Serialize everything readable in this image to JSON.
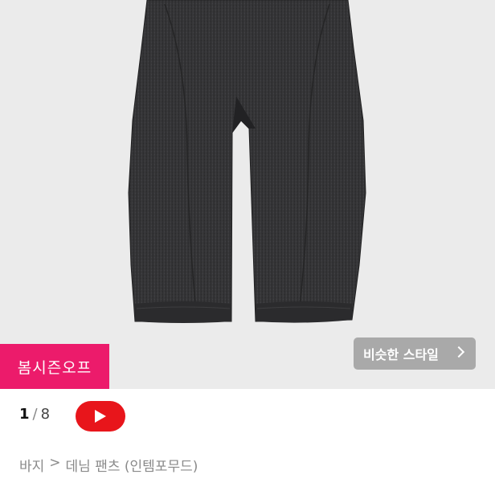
{
  "hero": {
    "product_image": "dark-grey-denim-balloon-pants",
    "sale_badge_label": "봄시즌오프",
    "similar_style_label": "비슷한 스타일",
    "chevron_icon": "chevron-right-icon"
  },
  "gallery": {
    "current_page": "1",
    "separator": "/",
    "total_pages": "8",
    "video_icon": "youtube-play-icon"
  },
  "breadcrumb": {
    "category": "바지",
    "separator": ">",
    "subcategory": "데님 팬츠 (인템포무드)"
  },
  "colors": {
    "sale_badge": "#ec1b6b",
    "video_button": "#e8151b",
    "similar_button": "#a9a9a9",
    "hero_background": "#ebebeb"
  }
}
